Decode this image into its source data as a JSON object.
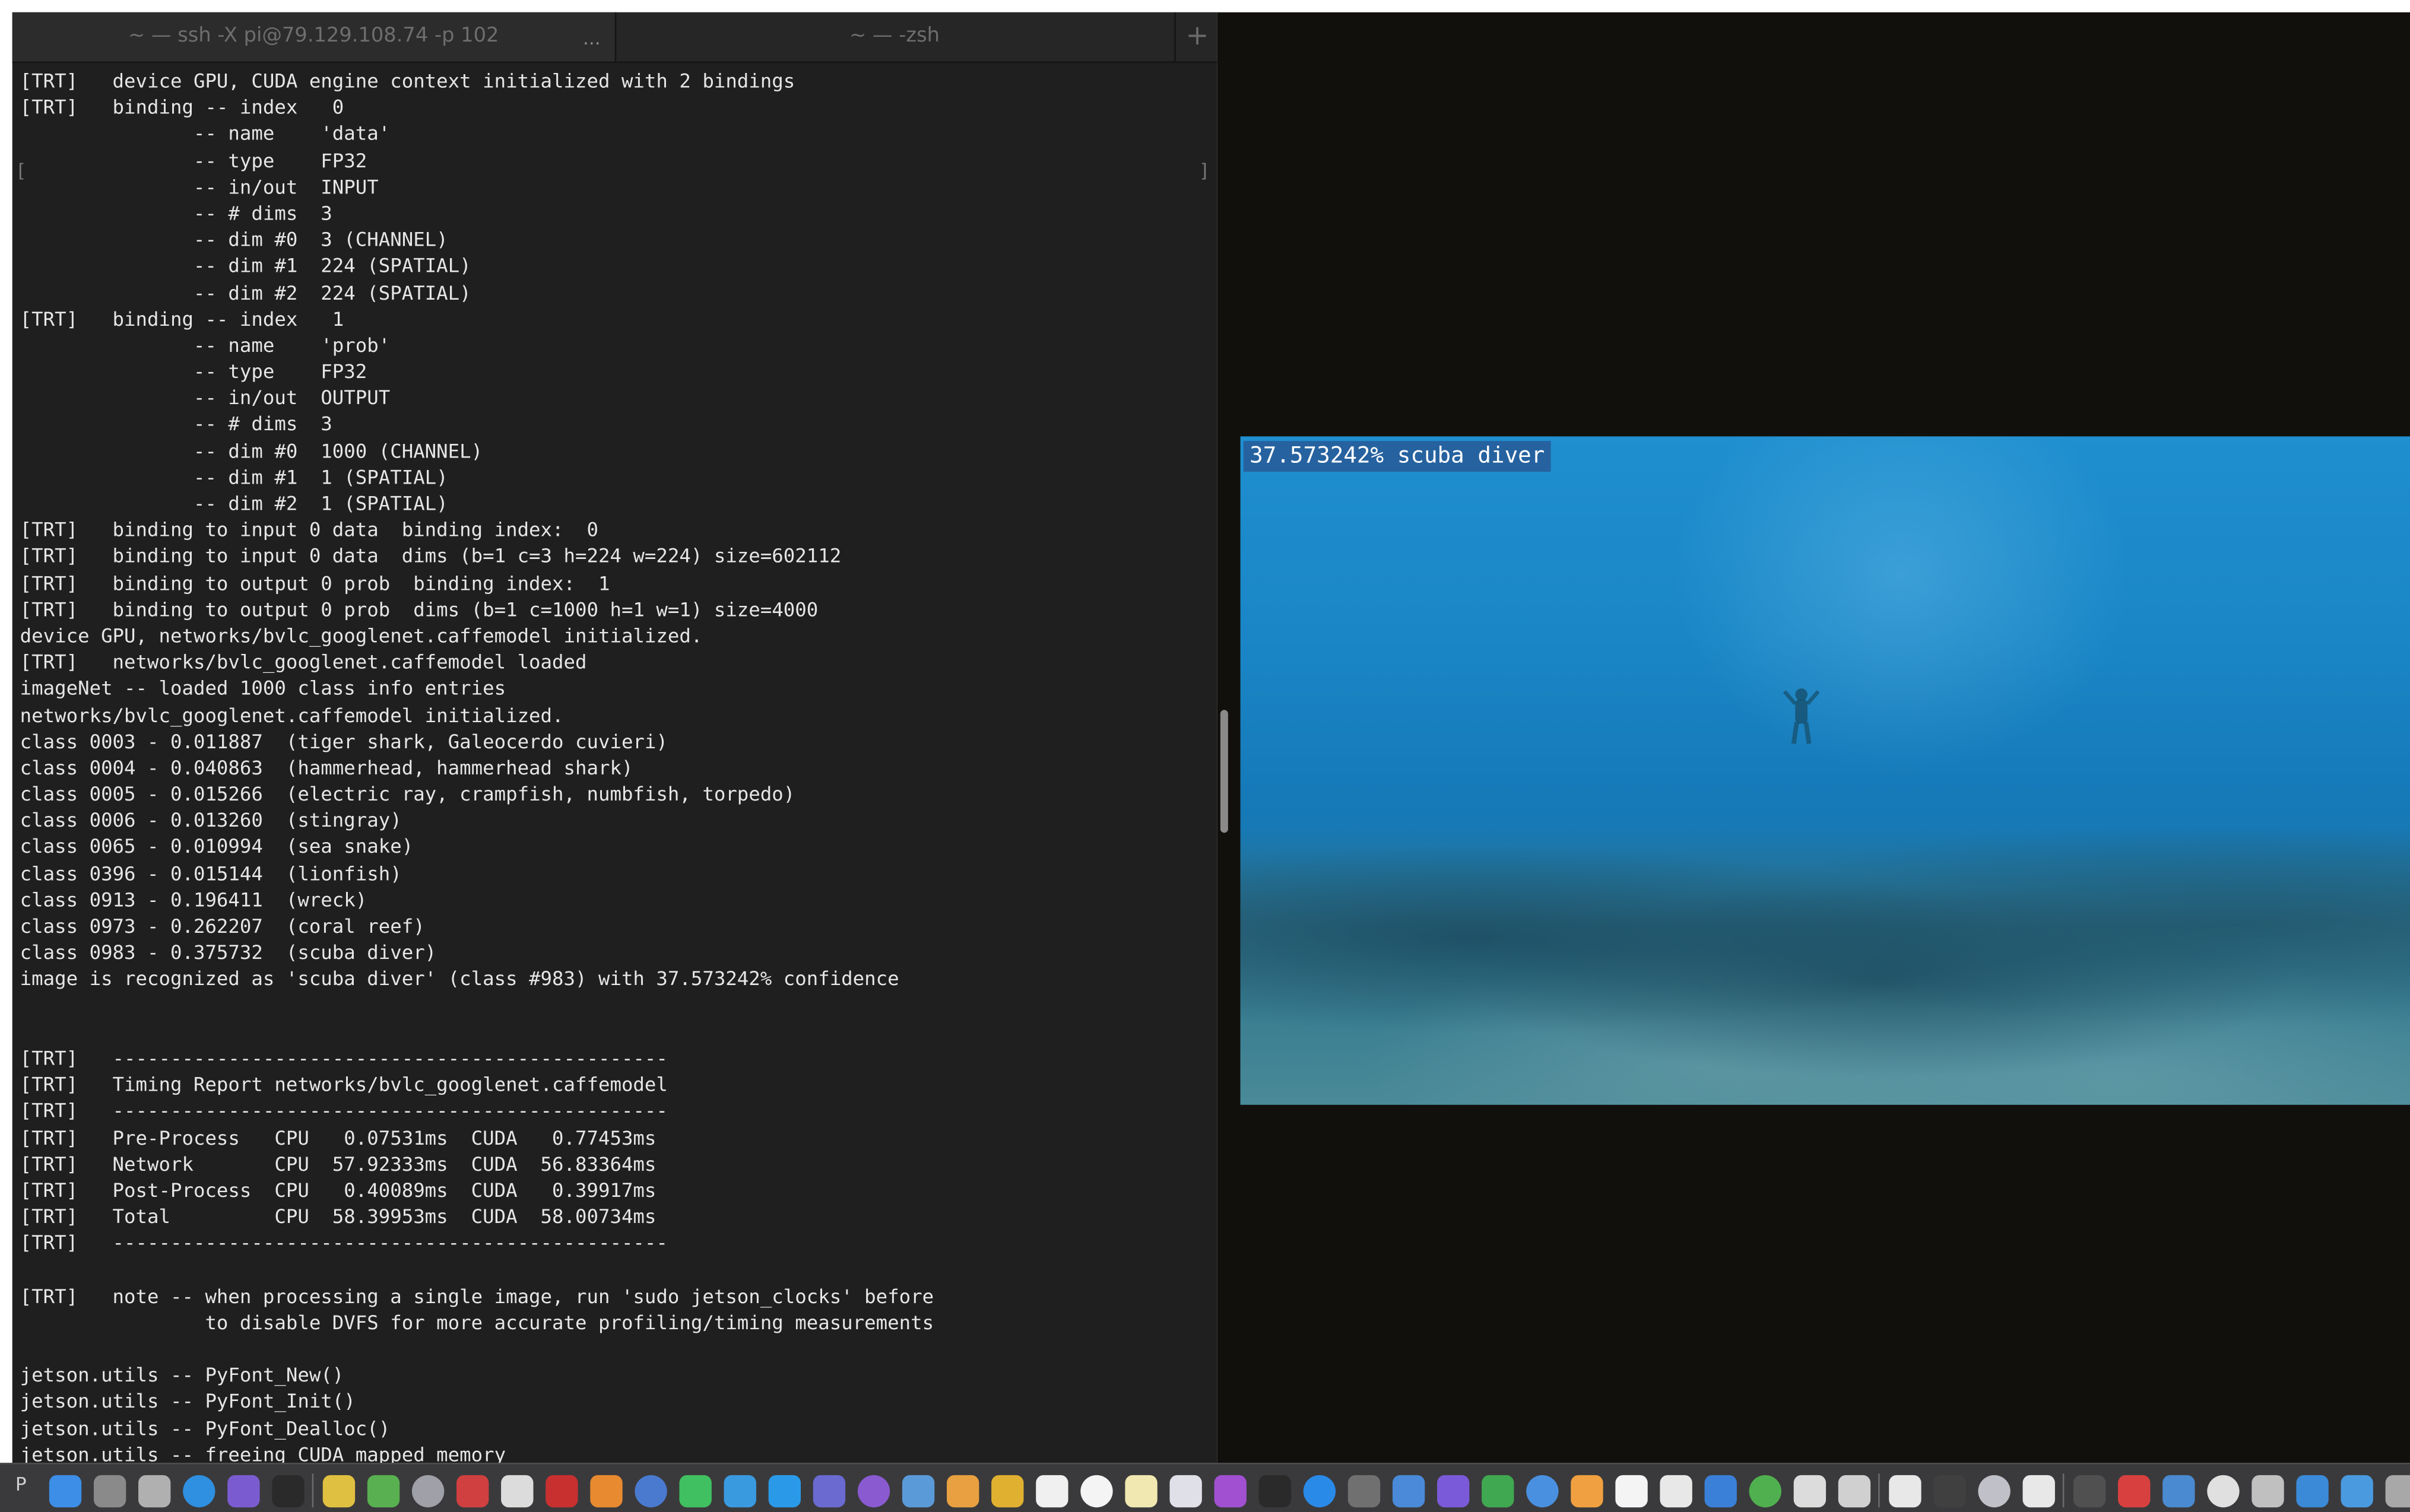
{
  "tabs": {
    "ssh": "~ — ssh -X pi@79.129.108.74 -p 102",
    "zsh": "~ — -zsh",
    "more": "...",
    "new_tab": "+"
  },
  "terminal_lines": [
    "[TRT]   device GPU, CUDA engine context initialized with 2 bindings",
    "[TRT]   binding -- index   0",
    "               -- name    'data'",
    "               -- type    FP32",
    "               -- in/out  INPUT",
    "               -- # dims  3",
    "               -- dim #0  3 (CHANNEL)",
    "               -- dim #1  224 (SPATIAL)",
    "               -- dim #2  224 (SPATIAL)",
    "[TRT]   binding -- index   1",
    "               -- name    'prob'",
    "               -- type    FP32",
    "               -- in/out  OUTPUT",
    "               -- # dims  3",
    "               -- dim #0  1000 (CHANNEL)",
    "               -- dim #1  1 (SPATIAL)",
    "               -- dim #2  1 (SPATIAL)",
    "[TRT]   binding to input 0 data  binding index:  0",
    "[TRT]   binding to input 0 data  dims (b=1 c=3 h=224 w=224) size=602112",
    "[TRT]   binding to output 0 prob  binding index:  1",
    "[TRT]   binding to output 0 prob  dims (b=1 c=1000 h=1 w=1) size=4000",
    "device GPU, networks/bvlc_googlenet.caffemodel initialized.",
    "[TRT]   networks/bvlc_googlenet.caffemodel loaded",
    "imageNet -- loaded 1000 class info entries",
    "networks/bvlc_googlenet.caffemodel initialized.",
    "class 0003 - 0.011887  (tiger shark, Galeocerdo cuvieri)",
    "class 0004 - 0.040863  (hammerhead, hammerhead shark)",
    "class 0005 - 0.015266  (electric ray, crampfish, numbfish, torpedo)",
    "class 0006 - 0.013260  (stingray)",
    "class 0065 - 0.010994  (sea snake)",
    "class 0396 - 0.015144  (lionfish)",
    "class 0913 - 0.196411  (wreck)",
    "class 0973 - 0.262207  (coral reef)",
    "class 0983 - 0.375732  (scuba diver)",
    "image is recognized as 'scuba diver' (class #983) with 37.573242% confidence",
    "",
    "",
    "[TRT]   ------------------------------------------------",
    "[TRT]   Timing Report networks/bvlc_googlenet.caffemodel",
    "[TRT]   ------------------------------------------------",
    "[TRT]   Pre-Process   CPU   0.07531ms  CUDA   0.77453ms",
    "[TRT]   Network       CPU  57.92333ms  CUDA  56.83364ms",
    "[TRT]   Post-Process  CPU   0.40089ms  CUDA   0.39917ms",
    "[TRT]   Total         CPU  58.39953ms  CUDA  58.00734ms",
    "[TRT]   ------------------------------------------------",
    "",
    "[TRT]   note -- when processing a single image, run 'sudo jetson_clocks' before",
    "                to disable DVFS for more accurate profiling/timing measurements",
    "",
    "jetson.utils -- PyFont_New()",
    "jetson.utils -- PyFont_Init()",
    "jetson.utils -- PyFont_Dealloc()",
    "jetson.utils -- freeing CUDA mapped memory"
  ],
  "prediction_label": "37.573242% scuba diver",
  "dock_partial_text": "P",
  "colors": {
    "terminal_bg": "#1f1f1f",
    "terminal_text": "#e6e6e6",
    "viewer_bg": "#12100d",
    "water_top": "#1f8fcf",
    "label_bg": "#285a96"
  },
  "dock_icons": [
    {
      "name": "finder-icon",
      "color": "#3c8ee6"
    },
    {
      "name": "system-preferences-icon",
      "color": "#8a8a8a"
    },
    {
      "name": "launchpad-icon",
      "color": "#b0b0b0"
    },
    {
      "name": "safari-icon",
      "color": "#2f8fe0"
    },
    {
      "name": "siri-icon",
      "color": "#7a5cd0"
    },
    {
      "name": "terminal-icon",
      "color": "#2a2a2a"
    },
    {
      "name": "photos-app-icon",
      "color": "#e0c040"
    },
    {
      "name": "maps-icon",
      "color": "#58b050"
    },
    {
      "name": "preview-icon",
      "color": "#a0a0a8"
    },
    {
      "name": "bug-app-icon",
      "color": "#d04040"
    },
    {
      "name": "settings-gear-icon",
      "color": "#dcdcdc"
    },
    {
      "name": "filezilla-icon",
      "color": "#c83030"
    },
    {
      "name": "blender-icon",
      "color": "#e88a30"
    },
    {
      "name": "document-viewer-icon",
      "color": "#4a7ad0"
    },
    {
      "name": "messages-icon",
      "color": "#40c060"
    },
    {
      "name": "chat-bubble-icon",
      "color": "#3a9ae0"
    },
    {
      "name": "skype-icon",
      "color": "#2a9ae8"
    },
    {
      "name": "teams-icon",
      "color": "#6a6ad0"
    },
    {
      "name": "viber-icon",
      "color": "#8a5ad0"
    },
    {
      "name": "mail-icon",
      "color": "#5a9ad8"
    },
    {
      "name": "photos-icon",
      "color": "#e8a040"
    },
    {
      "name": "notes-icon",
      "color": "#e0b030"
    },
    {
      "name": "calendar-icon",
      "color": "#f0f0f0"
    },
    {
      "name": "reminders-icon",
      "color": "#f4f4f4"
    },
    {
      "name": "stickies-icon",
      "color": "#f0e8b0"
    },
    {
      "name": "itunes-icon",
      "color": "#e0e0e8"
    },
    {
      "name": "podcasts-icon",
      "color": "#a050d0"
    },
    {
      "name": "apple-tv-icon",
      "color": "#2a2a2a"
    },
    {
      "name": "app-store-icon",
      "color": "#2a8ae8"
    },
    {
      "name": "drone-icon",
      "color": "#707070"
    },
    {
      "name": "xcode-icon",
      "color": "#4a8ad8"
    },
    {
      "name": "imovie-icon",
      "color": "#7a5ad8"
    },
    {
      "name": "numbers-icon",
      "color": "#40a850"
    },
    {
      "name": "keynote-icon",
      "color": "#4a90e0"
    },
    {
      "name": "pages-icon",
      "color": "#f0a040"
    },
    {
      "name": "textedit-icon",
      "color": "#f4f4f4"
    },
    {
      "name": "script-editor-icon",
      "color": "#e8e8e8"
    },
    {
      "name": "vlc-icon",
      "color": "#3a80d8"
    },
    {
      "name": "chrome-icon",
      "color": "#50b050"
    },
    {
      "name": "screenshot-icon",
      "color": "#dcdcdc"
    },
    {
      "name": "archive-icon",
      "color": "#d0d0d0"
    },
    {
      "name": "unity-icon",
      "color": "#e8e8e8"
    },
    {
      "name": "activity-monitor-icon",
      "color": "#404040"
    },
    {
      "name": "disk-utility-icon",
      "color": "#c0c0c8"
    },
    {
      "name": "document-icon",
      "color": "#e8e8e8"
    },
    {
      "name": "window-1-icon",
      "color": "#505050"
    },
    {
      "name": "window-2-icon",
      "color": "#d84040"
    },
    {
      "name": "window-3-icon",
      "color": "#4a8ad0"
    },
    {
      "name": "window-4-icon",
      "color": "#e0e0e0"
    },
    {
      "name": "window-5-icon",
      "color": "#c0c0c0"
    },
    {
      "name": "window-6-icon",
      "color": "#3a8ad8"
    },
    {
      "name": "window-7-icon",
      "color": "#4a9ae0"
    },
    {
      "name": "trash-icon",
      "color": "#a8a8a8"
    }
  ]
}
